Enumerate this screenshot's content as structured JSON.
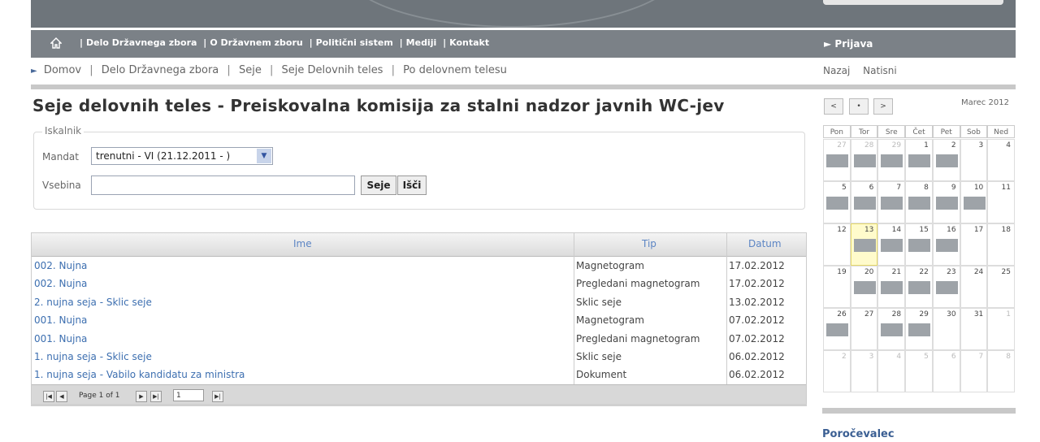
{
  "topnav": {
    "links": [
      "Delo Državnega zbora",
      "O Državnem zboru",
      "Politični sistem",
      "Mediji",
      "Kontakt"
    ],
    "login": "Prijava"
  },
  "breadcrumb": {
    "items": [
      "Domov",
      "Delo Državnega zbora",
      "Seje",
      "Seje Delovnih teles",
      "Po delovnem telesu"
    ]
  },
  "tools": {
    "back": "Nazaj",
    "print": "Natisni"
  },
  "page": {
    "title": "Seje delovnih teles - Preiskovalna komisija za stalni nadzor javnih WC-jev"
  },
  "search": {
    "legend": "Iskalnik",
    "mandate_label": "Mandat",
    "mandate_value": "trenutni - VI (21.12.2011 - )",
    "content_label": "Vsebina",
    "content_value": "",
    "btn_seje": "Seje",
    "btn_isci": "Išči"
  },
  "table": {
    "headers": [
      "Ime",
      "Tip",
      "Datum"
    ],
    "rows": [
      {
        "ime": "002. Nujna",
        "tip": "Magnetogram",
        "datum": "17.02.2012"
      },
      {
        "ime": "002. Nujna",
        "tip": "Pregledani magnetogram",
        "datum": "17.02.2012"
      },
      {
        "ime": "2. nujna seja - Sklic seje",
        "tip": "Sklic seje",
        "datum": "13.02.2012"
      },
      {
        "ime": "001. Nujna",
        "tip": "Magnetogram",
        "datum": "07.02.2012"
      },
      {
        "ime": "001. Nujna",
        "tip": "Pregledani magnetogram",
        "datum": "07.02.2012"
      },
      {
        "ime": "1. nujna seja - Sklic seje",
        "tip": "Sklic seje",
        "datum": "06.02.2012"
      },
      {
        "ime": "1. nujna seja - Vabilo kandidatu za ministra",
        "tip": "Dokument",
        "datum": "06.02.2012"
      }
    ],
    "pager": {
      "page_text": "Page 1 of 1",
      "page_value": "1"
    }
  },
  "calendar": {
    "nav": [
      "<",
      "•",
      ">"
    ],
    "month": "Marec 2012",
    "weekdays": [
      "Pon",
      "Tor",
      "Sre",
      "Čet",
      "Pet",
      "Sob",
      "Ned"
    ],
    "weeks": [
      [
        "27",
        "28",
        "29",
        "1",
        "2",
        "3",
        "4"
      ],
      [
        "5",
        "6",
        "7",
        "8",
        "9",
        "10",
        "11"
      ],
      [
        "12",
        "13",
        "14",
        "15",
        "16",
        "17",
        "18"
      ],
      [
        "19",
        "20",
        "21",
        "22",
        "23",
        "24",
        "25"
      ],
      [
        "26",
        "27",
        "28",
        "29",
        "30",
        "31",
        "1"
      ],
      [
        "2",
        "3",
        "4",
        "5",
        "6",
        "7",
        "8"
      ]
    ],
    "other_month": [
      [
        0,
        0
      ],
      [
        0,
        1
      ],
      [
        0,
        2
      ],
      [
        4,
        6
      ],
      [
        5,
        0
      ],
      [
        5,
        1
      ],
      [
        5,
        2
      ],
      [
        5,
        3
      ],
      [
        5,
        4
      ],
      [
        5,
        5
      ],
      [
        5,
        6
      ]
    ],
    "today": [
      2,
      1
    ],
    "events": [
      [
        0,
        0
      ],
      [
        0,
        1
      ],
      [
        0,
        2
      ],
      [
        0,
        3
      ],
      [
        0,
        4
      ],
      [
        1,
        0
      ],
      [
        1,
        1
      ],
      [
        1,
        2
      ],
      [
        1,
        3
      ],
      [
        1,
        4
      ],
      [
        1,
        5
      ],
      [
        2,
        1
      ],
      [
        2,
        2
      ],
      [
        2,
        3
      ],
      [
        2,
        4
      ],
      [
        3,
        1
      ],
      [
        3,
        2
      ],
      [
        3,
        3
      ],
      [
        3,
        4
      ],
      [
        4,
        0
      ],
      [
        4,
        2
      ],
      [
        4,
        3
      ]
    ]
  },
  "sidebar": {
    "porocevalec": "Poročevalec"
  },
  "colors": {
    "nav_bg": "#7b8187",
    "link": "#3d6fb0",
    "event": "#9ea3a8",
    "today": "#fffbcc"
  }
}
